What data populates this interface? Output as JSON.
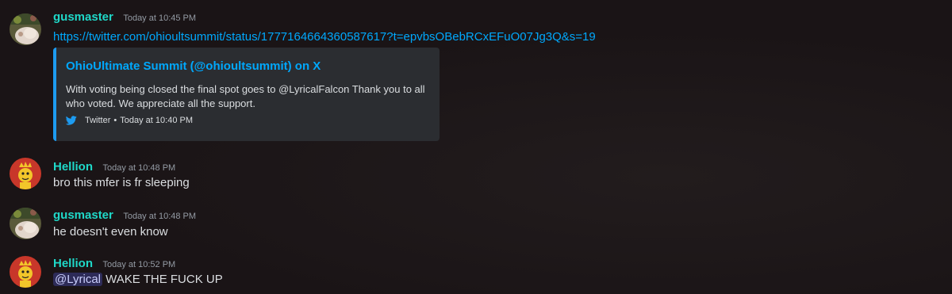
{
  "messages": [
    {
      "username": "gusmaster",
      "timestamp": "Today at 10:45 PM",
      "avatar_icon": "user-avatar-gusmaster",
      "link": "https://twitter.com/ohioultsummit/status/1777164664360587617?t=epvbsOBebRCxEFuO07Jg3Q&s=19",
      "embed": {
        "title": "OhioUltimate Summit (@ohioultsummit) on X",
        "description": "With voting being closed the final spot goes to @LyricalFalcon Thank you to all who voted. We appreciate all the support.",
        "footer_source": "Twitter",
        "footer_sep": "•",
        "footer_time": "Today at 10:40 PM",
        "footer_icon": "twitter-bird-icon",
        "accent_color": "#1d9bf0"
      }
    },
    {
      "username": "Hellion",
      "timestamp": "Today at 10:48 PM",
      "avatar_icon": "user-avatar-hellion",
      "text": "bro this mfer is fr sleeping"
    },
    {
      "username": "gusmaster",
      "timestamp": "Today at 10:48 PM",
      "avatar_icon": "user-avatar-gusmaster",
      "text": "he doesn't even know"
    },
    {
      "username": "Hellion",
      "timestamp": "Today at 10:52 PM",
      "avatar_icon": "user-avatar-hellion",
      "mention": "@Lyrical",
      "text": " WAKE THE FUCK UP"
    }
  ],
  "colors": {
    "background": "#1a1416",
    "username": "#1fd8c8",
    "link": "#00a8fc",
    "mention_bg": "#3b3f8c"
  }
}
